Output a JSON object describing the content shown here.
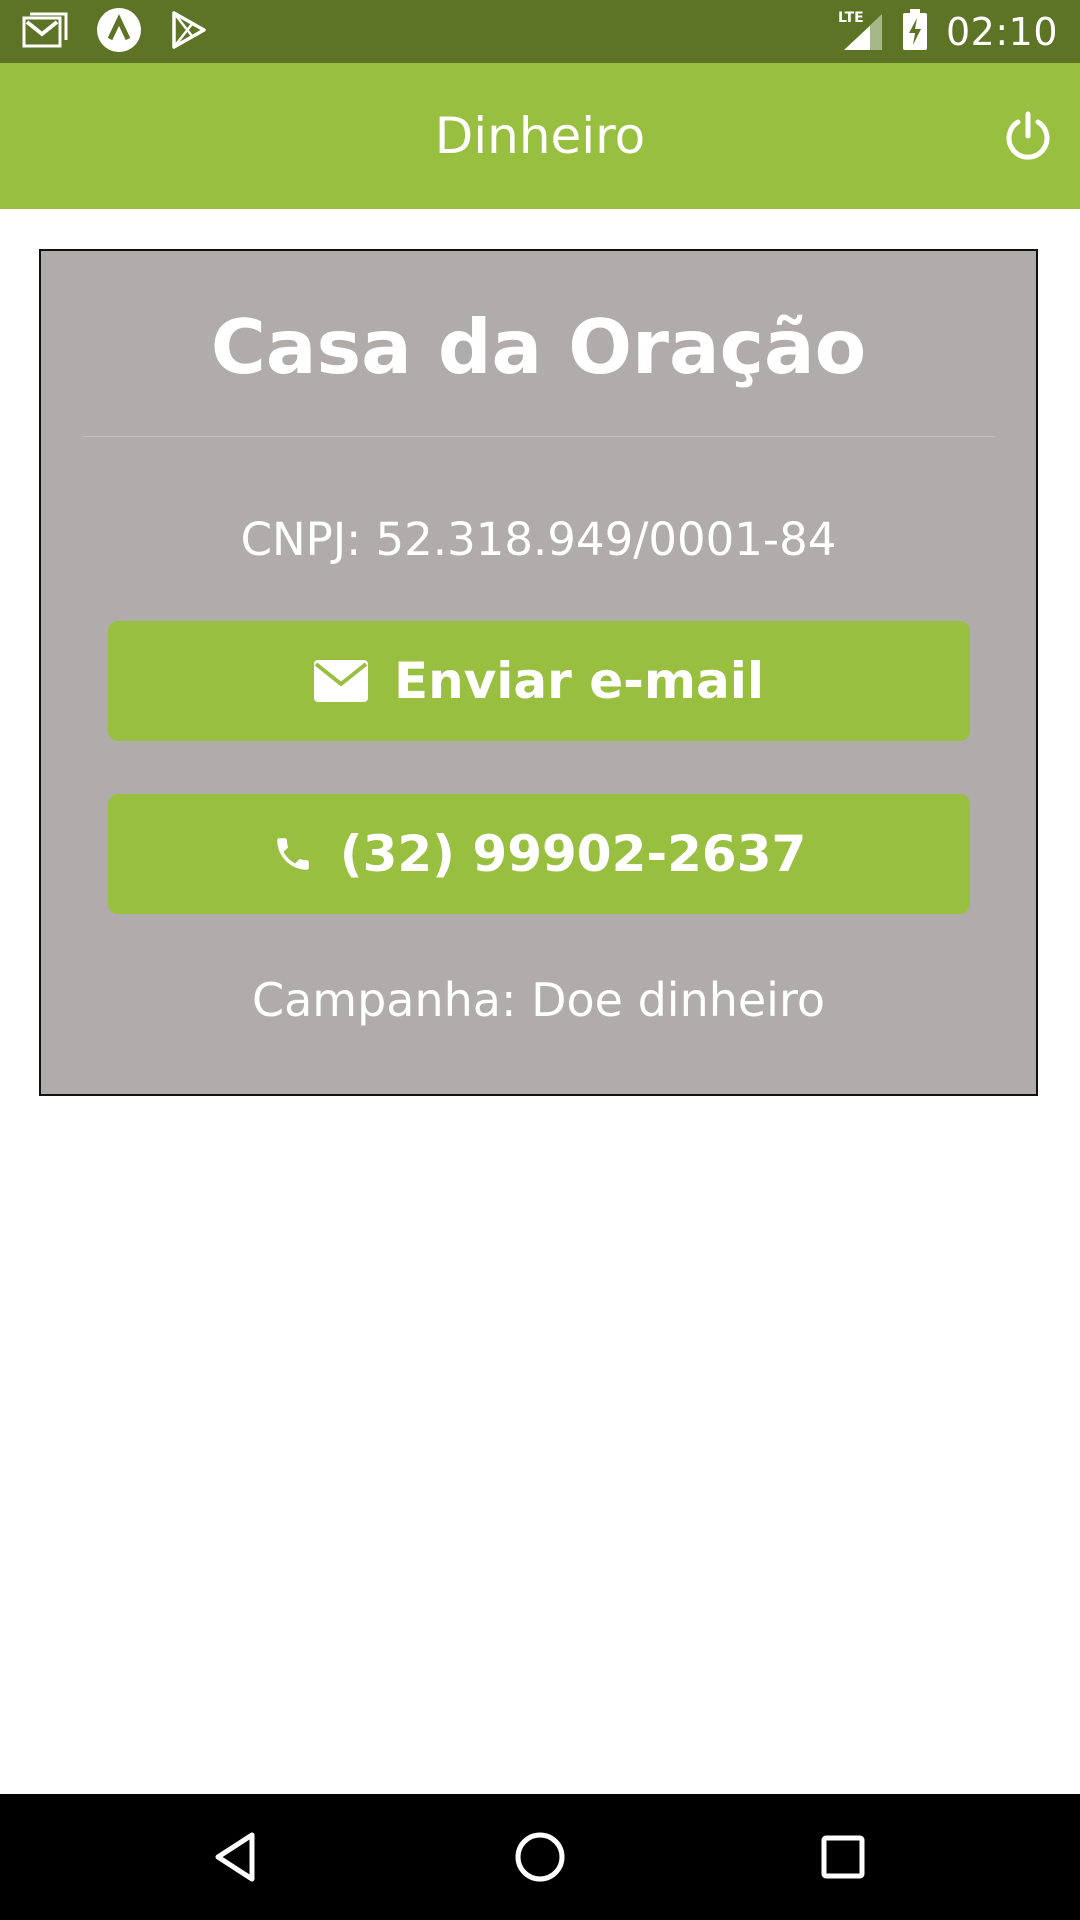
{
  "status_bar": {
    "time": "02:10",
    "network": "LTE",
    "icons": [
      "gmail-icon",
      "app-notification-icon",
      "play-store-icon",
      "lte-signal-icon",
      "battery-charging-icon"
    ]
  },
  "app_bar": {
    "title": "Dinheiro",
    "action_icon": "power-icon"
  },
  "card": {
    "title": "Casa da Oração",
    "cnpj": "CNPJ: 52.318.949/0001-84",
    "email_button": {
      "label": "Enviar e-mail",
      "icon": "envelope-icon"
    },
    "phone_button": {
      "label": "(32) 99902-2637",
      "icon": "phone-icon"
    },
    "campaign": "Campanha: Doe dinheiro"
  },
  "nav_bar": {
    "buttons": [
      "back-icon",
      "home-icon",
      "recents-icon"
    ]
  },
  "colors": {
    "status_bar": "#5d7325",
    "app_bar": "#98bf40",
    "card_background": "#b0acab",
    "button": "#98bf40",
    "text_on_color": "#ffffff",
    "nav_bar": "#000000"
  }
}
